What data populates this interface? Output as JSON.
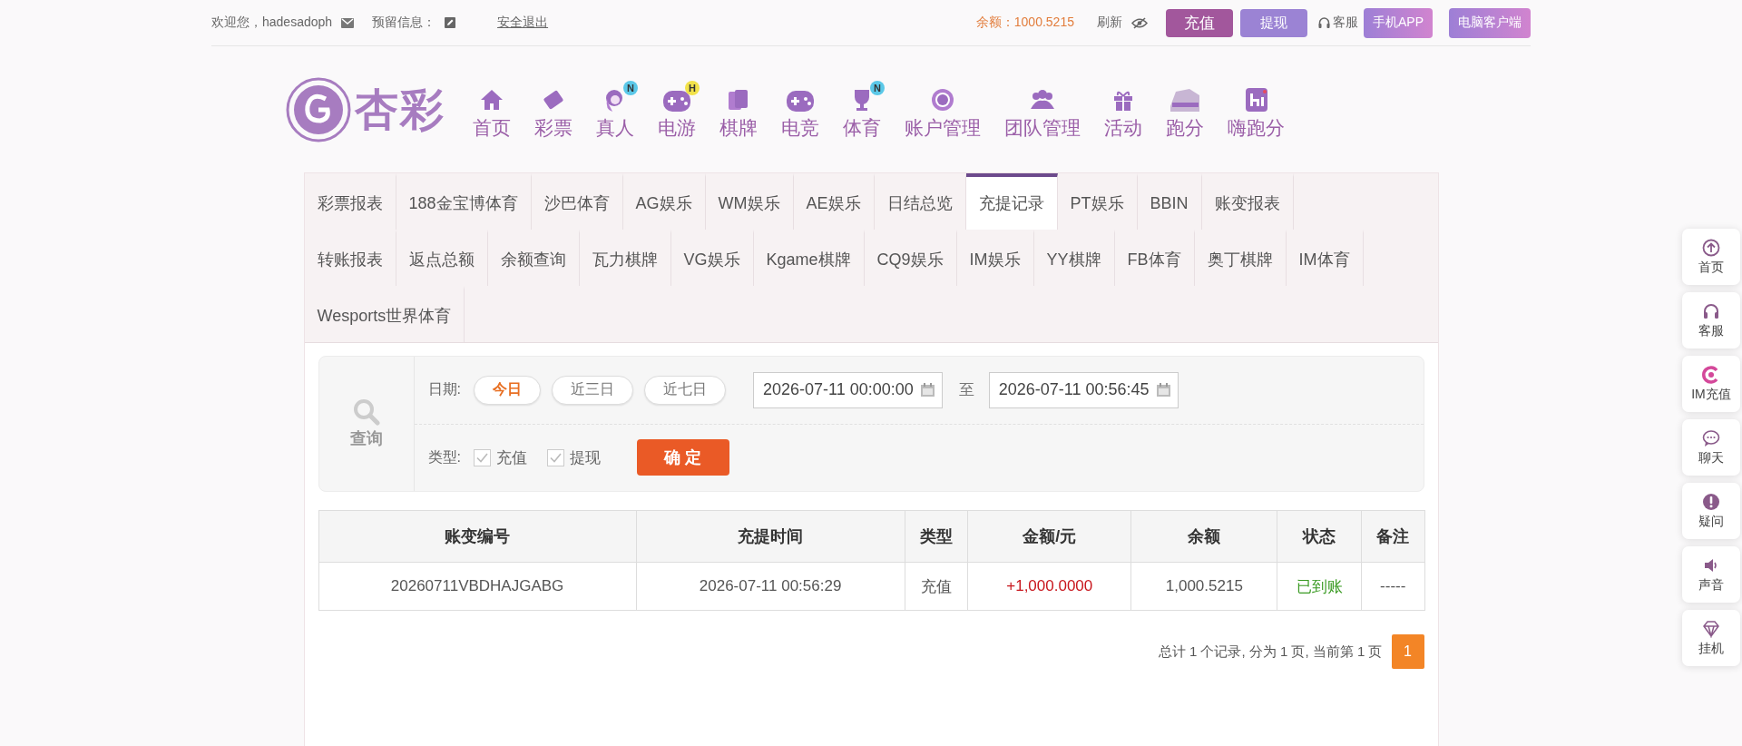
{
  "top_bar": {
    "welcome": "欢迎您，hadesadoph",
    "reserved_info": "预留信息：",
    "logout": "安全退出",
    "balance": "余额：1000.5215",
    "refresh": "刷新",
    "buttons": [
      {
        "label": "充值",
        "kind": "deposit"
      },
      {
        "label": "提现",
        "kind": "withdraw"
      }
    ],
    "service": "客服",
    "apps": [
      {
        "label": "手机APP"
      },
      {
        "label": "电脑客户端"
      }
    ]
  },
  "logo": {
    "text": "杏彩"
  },
  "nav": [
    {
      "label": "首页"
    },
    {
      "label": "彩票"
    },
    {
      "label": "真人",
      "badge": {
        "text": "N",
        "kind": "new"
      }
    },
    {
      "label": "电游",
      "badge": {
        "text": "H",
        "kind": "hot"
      }
    },
    {
      "label": "棋牌"
    },
    {
      "label": "电竞"
    },
    {
      "label": "体育",
      "badge": {
        "text": "N",
        "kind": "new"
      }
    },
    {
      "label": "账户管理"
    },
    {
      "label": "团队管理"
    },
    {
      "label": "活动"
    },
    {
      "label": "跑分"
    },
    {
      "label": "嗨跑分"
    }
  ],
  "tab_rows": [
    [
      {
        "label": "彩票报表",
        "selected": false
      },
      {
        "label": "188金宝博体育",
        "selected": false
      },
      {
        "label": "沙巴体育",
        "selected": false
      },
      {
        "label": "AG娱乐",
        "selected": false
      },
      {
        "label": "WM娱乐",
        "selected": false
      },
      {
        "label": "AE娱乐",
        "selected": false
      },
      {
        "label": "日结总览",
        "selected": false
      },
      {
        "label": "充提记录",
        "selected": true
      },
      {
        "label": "PT娱乐",
        "selected": false
      },
      {
        "label": "BBIN",
        "selected": false
      },
      {
        "label": "账变报表",
        "selected": false
      }
    ],
    [
      {
        "label": "转账报表",
        "selected": false
      },
      {
        "label": "返点总额",
        "selected": false
      },
      {
        "label": "余额查询",
        "selected": false
      },
      {
        "label": "瓦力棋牌",
        "selected": false
      },
      {
        "label": "VG娱乐",
        "selected": false
      },
      {
        "label": "Kgame棋牌",
        "selected": false
      },
      {
        "label": "CQ9娱乐",
        "selected": false
      },
      {
        "label": "IM娱乐",
        "selected": false
      },
      {
        "label": "YY棋牌",
        "selected": false
      },
      {
        "label": "FB体育",
        "selected": false
      },
      {
        "label": "奥丁棋牌",
        "selected": false
      },
      {
        "label": "IM体育",
        "selected": false
      }
    ],
    [
      {
        "label": "Wesports世界体育",
        "selected": false
      }
    ]
  ],
  "query": {
    "side_label": "查询",
    "date_label": "日期:",
    "ranges": [
      {
        "label": "今日",
        "selected": true
      },
      {
        "label": "近三日",
        "selected": false
      },
      {
        "label": "近七日",
        "selected": false
      }
    ],
    "start": "2026-07-11 00:00:00",
    "to": "至",
    "end": "2026-07-11 00:56:45",
    "type_label": "类型:",
    "types": [
      {
        "label": "充值",
        "checked": true
      },
      {
        "label": "提现",
        "checked": true
      }
    ],
    "submit": "确 定"
  },
  "table": {
    "columns": [
      "账变编号",
      "充提时间",
      "类型",
      "金额/元",
      "余额",
      "状态",
      "备注"
    ],
    "rows": [
      {
        "cells": [
          "20260711VBDHAJGABG",
          "2026-07-11 00:56:29",
          "充值",
          "+1,000.0000",
          "1,000.5215",
          "已到账",
          "-----"
        ]
      }
    ]
  },
  "pagination": {
    "summary": "总计 1 个记录, 分为 1 页, 当前第 1 页",
    "pages": [
      {
        "label": "1",
        "selected": true
      }
    ]
  },
  "float_menu": [
    {
      "label": "首页"
    },
    {
      "label": "客服"
    },
    {
      "label": "IM充值"
    },
    {
      "label": "聊天"
    },
    {
      "label": "疑问"
    },
    {
      "label": "声音"
    },
    {
      "label": "挂机"
    }
  ]
}
